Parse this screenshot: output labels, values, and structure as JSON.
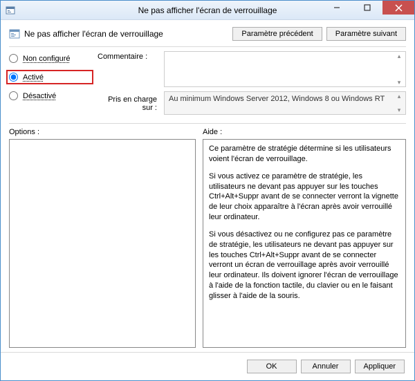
{
  "titlebar": {
    "title": "Ne pas afficher l'écran de verrouillage"
  },
  "header": {
    "title": "Ne pas afficher l'écran de verrouillage",
    "prev_button": "Paramètre précédent",
    "next_button": "Paramètre suivant"
  },
  "radios": {
    "not_configured": "Non configuré",
    "enabled": "Activé",
    "disabled": "Désactivé",
    "selected": "enabled"
  },
  "comment": {
    "label": "Commentaire :",
    "value": ""
  },
  "support": {
    "label": "Pris en charge sur :",
    "value": "Au minimum Windows Server 2012, Windows 8 ou Windows RT"
  },
  "options": {
    "label": "Options :"
  },
  "help": {
    "label": "Aide :",
    "p1": "Ce paramètre de stratégie détermine si les utilisateurs voient l'écran de verrouillage.",
    "p2": "Si vous activez ce paramètre de stratégie, les utilisateurs ne devant pas appuyer sur les touches Ctrl+Alt+Suppr avant de se connecter verront la vignette de leur choix apparaître à l'écran après avoir verrouillé leur ordinateur.",
    "p3": "Si vous désactivez ou ne configurez pas ce paramètre de stratégie, les utilisateurs ne devant pas appuyer sur les touches Ctrl+Alt+Suppr avant de se connecter verront un écran de verrouillage après avoir verrouillé leur ordinateur. Ils doivent ignorer l'écran de verrouillage à l'aide de la fonction tactile, du clavier ou en le faisant glisser à l'aide de la souris."
  },
  "footer": {
    "ok": "OK",
    "cancel": "Annuler",
    "apply": "Appliquer"
  }
}
